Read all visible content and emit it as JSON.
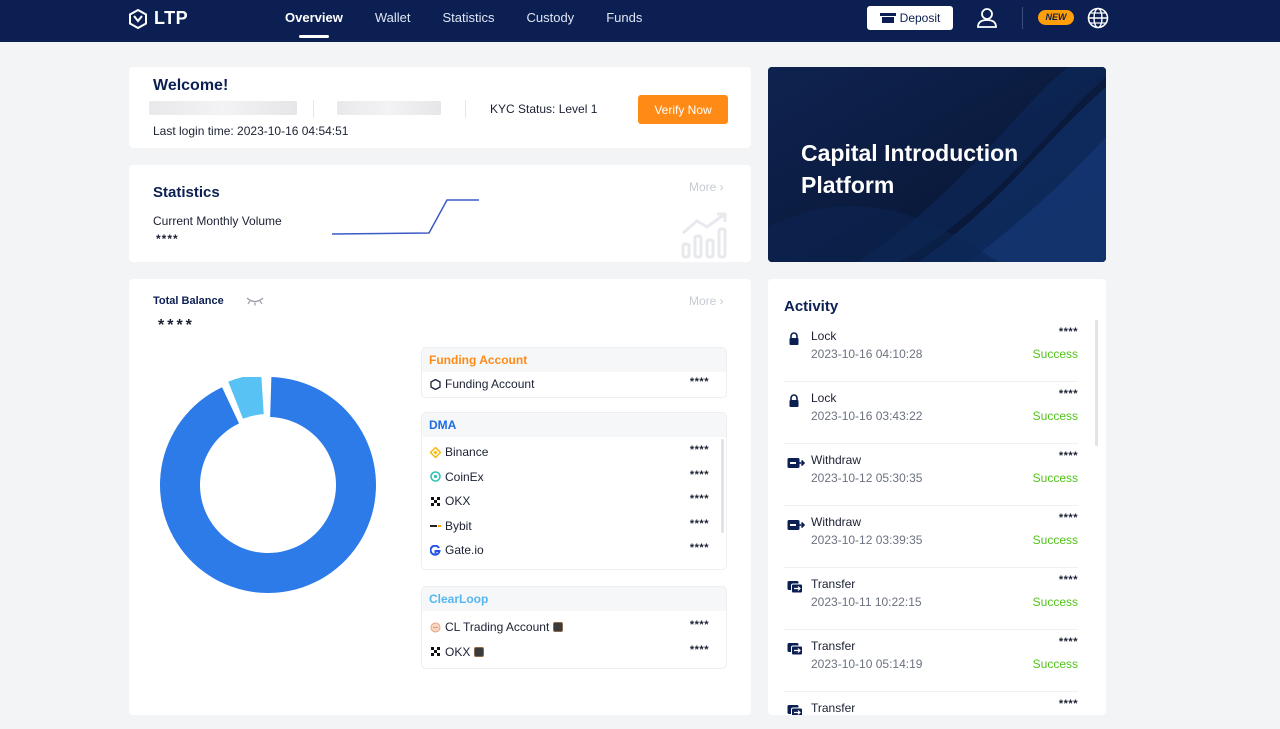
{
  "nav": {
    "logo_text": "LTP",
    "items": [
      {
        "label": "Overview",
        "active": true
      },
      {
        "label": "Wallet"
      },
      {
        "label": "Statistics"
      },
      {
        "label": "Custody"
      },
      {
        "label": "Funds"
      }
    ],
    "deposit_label": "Deposit",
    "new_badge": "NEW"
  },
  "welcome": {
    "title": "Welcome!",
    "kyc_status": "KYC Status: Level 1",
    "verify_label": "Verify Now",
    "last_login": "Last login time: 2023-10-16 04:54:51"
  },
  "statistics": {
    "title": "Statistics",
    "more_label": "More ›",
    "metric_label": "Current Monthly Volume",
    "metric_value": "****"
  },
  "capital_card": {
    "title": "Capital Introduction Platform"
  },
  "balance": {
    "title": "Total Balance",
    "more_label": "More ›",
    "value": "****",
    "donut_share": 0.96,
    "groups": [
      {
        "title": "Funding Account",
        "color": "#ff8a15",
        "rows": [
          {
            "label": "Funding Account",
            "value": "****",
            "icon": "ltp-icon"
          }
        ]
      },
      {
        "title": "DMA",
        "color": "#1f6ce0",
        "rows": [
          {
            "label": "Binance",
            "value": "****",
            "icon": "binance-icon"
          },
          {
            "label": "CoinEx",
            "value": "****",
            "icon": "coinex-icon"
          },
          {
            "label": "OKX",
            "value": "****",
            "icon": "okx-icon"
          },
          {
            "label": "Bybit",
            "value": "****",
            "icon": "bybit-icon"
          },
          {
            "label": "Gate.io",
            "value": "****",
            "icon": "gateio-icon"
          }
        ]
      },
      {
        "title": "ClearLoop",
        "color": "#55b6ee",
        "rows": [
          {
            "label": "CL Trading Account",
            "value": "****",
            "icon": "cl-icon"
          },
          {
            "label": "OKX",
            "value": "****",
            "icon": "okx-icon"
          }
        ]
      }
    ]
  },
  "activity": {
    "title": "Activity",
    "items": [
      {
        "type": "Lock",
        "time": "2023-10-16 04:10:28",
        "value": "****",
        "status": "Success",
        "icon": "lock-icon"
      },
      {
        "type": "Lock",
        "time": "2023-10-16 03:43:22",
        "value": "****",
        "status": "Success",
        "icon": "lock-icon"
      },
      {
        "type": "Withdraw",
        "time": "2023-10-12 05:30:35",
        "value": "****",
        "status": "Success",
        "icon": "withdraw-icon"
      },
      {
        "type": "Withdraw",
        "time": "2023-10-12 03:39:35",
        "value": "****",
        "status": "Success",
        "icon": "withdraw-icon"
      },
      {
        "type": "Transfer",
        "time": "2023-10-11 10:22:15",
        "value": "****",
        "status": "Success",
        "icon": "transfer-icon"
      },
      {
        "type": "Transfer",
        "time": "2023-10-10 05:14:19",
        "value": "****",
        "status": "Success",
        "icon": "transfer-icon"
      },
      {
        "type": "Transfer",
        "time": "",
        "value": "****",
        "status": "",
        "icon": "transfer-icon"
      }
    ]
  }
}
